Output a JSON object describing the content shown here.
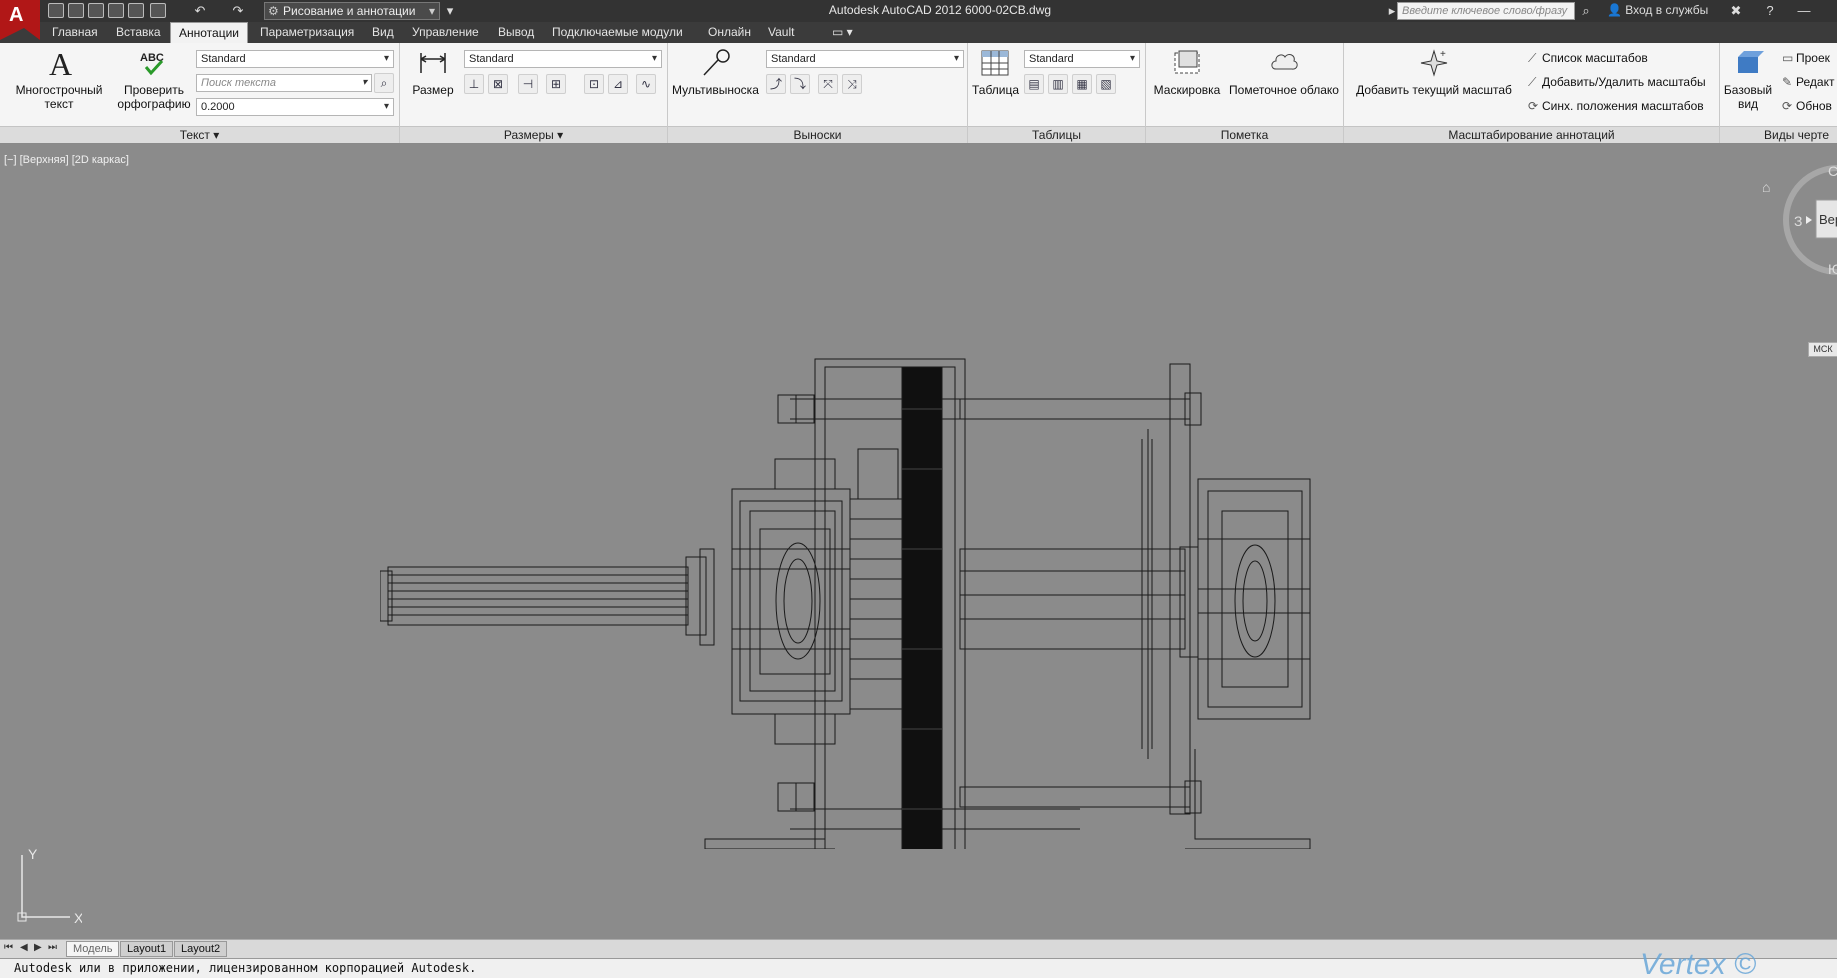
{
  "app": {
    "workspace": "Рисование и аннотации",
    "document_title": "Autodesk AutoCAD 2012  6000-02CB.dwg",
    "search_placeholder": "Введите ключевое слово/фразу",
    "sign_in": "Вход в службы"
  },
  "tabs": [
    {
      "label": "Главная"
    },
    {
      "label": "Вставка"
    },
    {
      "label": "Аннотации"
    },
    {
      "label": "Параметризация"
    },
    {
      "label": "Вид"
    },
    {
      "label": "Управление"
    },
    {
      "label": "Вывод"
    },
    {
      "label": "Подключаемые модули"
    },
    {
      "label": "Онлайн"
    },
    {
      "label": "Vault"
    }
  ],
  "ribbon": {
    "text": {
      "title": "Текст",
      "mtext": "Многострочный текст",
      "spell": "Проверить орфографию",
      "style": "Standard",
      "search_placeholder": "Поиск текста",
      "height": "0.2000"
    },
    "dims": {
      "title": "Размеры",
      "button": "Размер",
      "style": "Standard"
    },
    "leaders": {
      "title": "Выноски",
      "button": "Мультивыноска",
      "style": "Standard"
    },
    "tables": {
      "title": "Таблицы",
      "button": "Таблица",
      "style": "Standard"
    },
    "markup": {
      "title": "Пометка",
      "wipeout": "Маскировка",
      "cloud": "Пометочное облако"
    },
    "scaling": {
      "title": "Масштабирование аннотаций",
      "add_current": "Добавить текущий масштаб",
      "links": [
        "Список масштабов",
        "Добавить/Удалить масштабы",
        "Синх. положения масштабов"
      ]
    },
    "views": {
      "title": "Виды черте",
      "base": "Базовый вид",
      "links": [
        "Проек",
        "Редакт",
        "Обнов"
      ]
    }
  },
  "viewport": {
    "label": "[−] [Верхняя] [2D каркас]",
    "ucs_y": "Y",
    "ucs_x": "X",
    "viewcube_face": "Вер",
    "viewcube_w": "З",
    "viewcube_s": "Ю",
    "viewcube_n": "С",
    "wcs": "МСК"
  },
  "layouts": [
    "Модель",
    "Layout1",
    "Layout2"
  ],
  "command_line": "Autodesk или в приложении, лицензированном корпорацией Autodesk.",
  "watermark": "Vertex ©",
  "colors": {
    "viewport_bg": "#8b8b8b",
    "accent": "#b11717",
    "drawing_lines": "#1a1a1a"
  }
}
